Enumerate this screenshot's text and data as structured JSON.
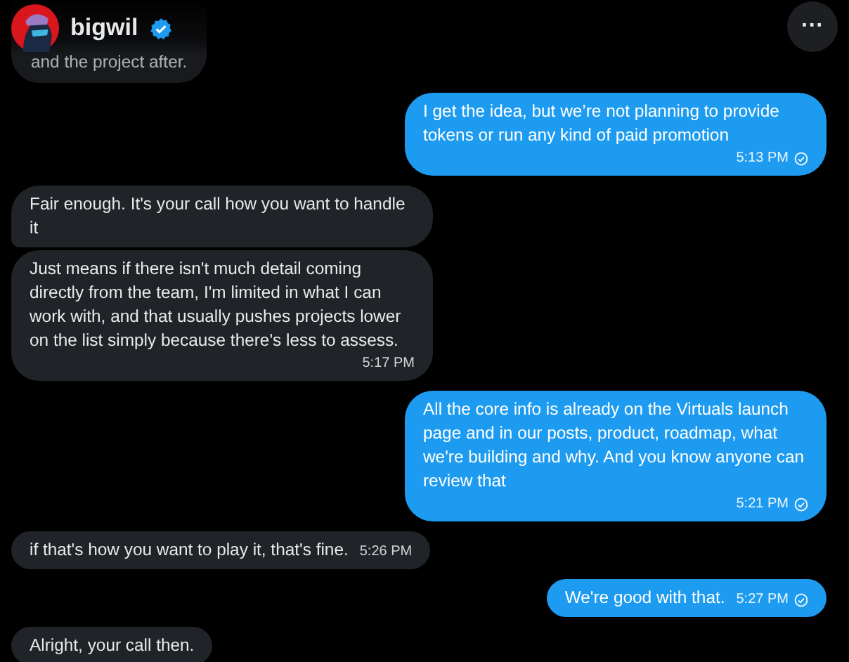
{
  "header": {
    "name": "bigwil",
    "verified": true,
    "more_label": "···"
  },
  "messages": [
    {
      "kind": "received",
      "text": "and the project after."
    },
    {
      "kind": "sent",
      "text": "I get the idea, but we’re not planning to provide tokens or run any kind of paid promotion",
      "time": "5:13 PM",
      "time_inline": false,
      "read": true
    },
    {
      "kind": "received",
      "text": "Fair enough. It's your call how you want to handle it"
    },
    {
      "kind": "received",
      "text": "Just means if there isn't much detail coming directly from the team, I'm limited in what I can work with, and that usually pushes projects lower on the list simply because there's less to assess.",
      "time": "5:17 PM",
      "time_inline": false
    },
    {
      "kind": "sent",
      "text": "All the core info is already on the Virtuals launch page and in our posts, product, roadmap, what we're building and why. And you know anyone can review that",
      "time": "5:21 PM",
      "time_inline": false,
      "read": true
    },
    {
      "kind": "received",
      "text": "if that's how you want to play it, that's fine.",
      "time": "5:26 PM",
      "time_inline": true
    },
    {
      "kind": "sent",
      "text": "We're good with that.",
      "time": "5:27 PM",
      "time_inline": true,
      "read": true
    },
    {
      "kind": "received",
      "text": "Alright, your call then."
    }
  ]
}
